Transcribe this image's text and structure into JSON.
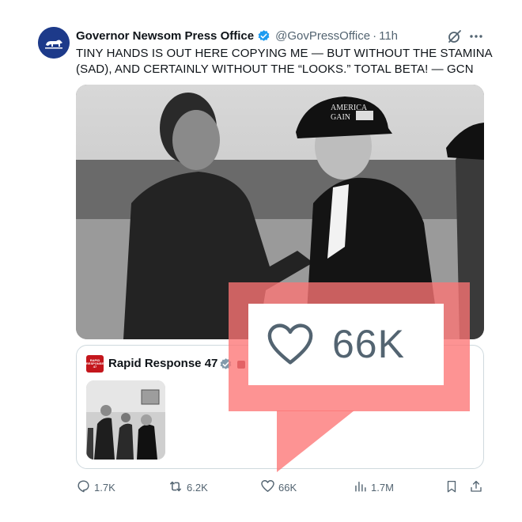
{
  "tweet": {
    "display_name": "Governor Newsom Press Office",
    "handle": "@GovPressOffice",
    "separator": "·",
    "time": "11h",
    "text_lines": [
      "TINY HANDS IS OUT HERE COPYING ME — BUT WITHOUT THE STAMINA",
      "(SAD), AND CERTAINLY WITHOUT THE “LOOKS.” TOTAL BETA! — GCN"
    ],
    "hat_text": [
      "AMERICA",
      "GAIN"
    ]
  },
  "quote": {
    "display_name": "Rapid Response 47",
    "avatar_text": [
      "RAPID",
      "RESPONSE",
      "47"
    ]
  },
  "callout": {
    "likes": "66K"
  },
  "actions": {
    "replies": "1.7K",
    "reposts": "6.2K",
    "likes": "66K",
    "views": "1.7M"
  },
  "colors": {
    "verified": "#1d9bf0",
    "callout": "#fc7474",
    "muted": "#536471",
    "avatar_bg": "#1d3a8a"
  }
}
